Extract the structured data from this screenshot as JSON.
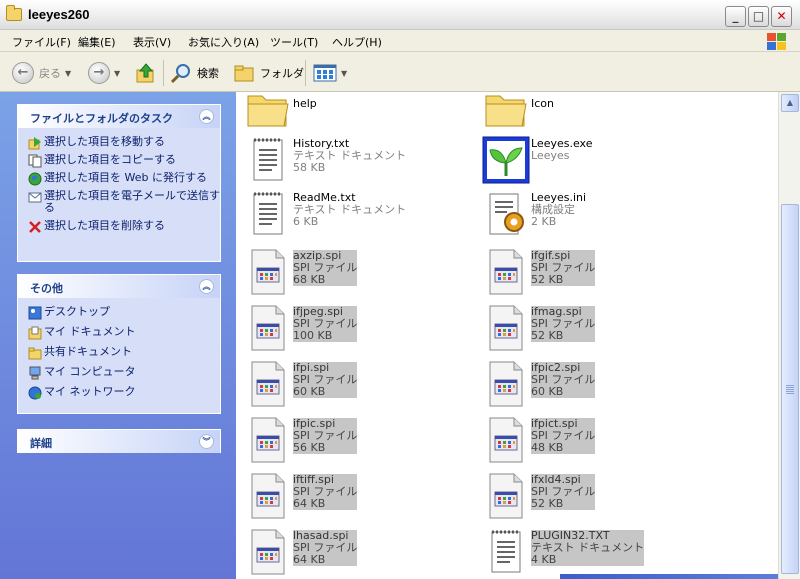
{
  "window": {
    "title": "leeyes260"
  },
  "menu": [
    "ファイル(F)",
    "編集(E)",
    "表示(V)",
    "お気に入り(A)",
    "ツール(T)",
    "ヘルプ(H)"
  ],
  "toolbar": {
    "back": "戻る",
    "forward": "",
    "search": "検索",
    "folders": "フォルダ"
  },
  "tasks": {
    "file_tasks": {
      "title": "ファイルとフォルダのタスク",
      "items": [
        "選択した項目を移動する",
        "選択した項目をコピーする",
        "選択した項目を Web に発行する",
        "選択した項目を電子メールで送信する",
        "選択した項目を削除する"
      ]
    },
    "other": {
      "title": "その他",
      "items": [
        "デスクトップ",
        "マイ ドキュメント",
        "共有ドキュメント",
        "マイ コンピュータ",
        "マイ ネットワーク"
      ]
    },
    "details": {
      "title": "詳細"
    }
  },
  "files": [
    {
      "name": "help",
      "type": "",
      "size": "",
      "icon": "folder-icon",
      "selected": false
    },
    {
      "name": "Icon",
      "type": "",
      "size": "",
      "icon": "folder-icon",
      "selected": false
    },
    {
      "name": "History.txt",
      "type": "テキスト ドキュメント",
      "size": "58 KB",
      "icon": "text-document-icon",
      "selected": false
    },
    {
      "name": "Leeyes.exe",
      "type": "Leeyes",
      "size": "",
      "icon": "leeyes-app-icon",
      "selected": false
    },
    {
      "name": "ReadMe.txt",
      "type": "テキスト ドキュメント",
      "size": "6 KB",
      "icon": "text-document-icon",
      "selected": false
    },
    {
      "name": "Leeyes.ini",
      "type": "構成設定",
      "size": "2 KB",
      "icon": "config-settings-icon",
      "selected": false
    },
    {
      "name": "axzip.spi",
      "type": "SPI ファイル",
      "size": "68 KB",
      "icon": "spi-file-icon",
      "selected": true
    },
    {
      "name": "ifgif.spi",
      "type": "SPI ファイル",
      "size": "52 KB",
      "icon": "spi-file-icon",
      "selected": true
    },
    {
      "name": "ifjpeg.spi",
      "type": "SPI ファイル",
      "size": "100 KB",
      "icon": "spi-file-icon",
      "selected": true
    },
    {
      "name": "ifmag.spi",
      "type": "SPI ファイル",
      "size": "52 KB",
      "icon": "spi-file-icon",
      "selected": true
    },
    {
      "name": "ifpi.spi",
      "type": "SPI ファイル",
      "size": "60 KB",
      "icon": "spi-file-icon",
      "selected": true
    },
    {
      "name": "ifpic2.spi",
      "type": "SPI ファイル",
      "size": "60 KB",
      "icon": "spi-file-icon",
      "selected": true
    },
    {
      "name": "ifpic.spi",
      "type": "SPI ファイル",
      "size": "56 KB",
      "icon": "spi-file-icon",
      "selected": true
    },
    {
      "name": "ifpict.spi",
      "type": "SPI ファイル",
      "size": "48 KB",
      "icon": "spi-file-icon",
      "selected": true
    },
    {
      "name": "iftiff.spi",
      "type": "SPI ファイル",
      "size": "64 KB",
      "icon": "spi-file-icon",
      "selected": true
    },
    {
      "name": "ifxld4.spi",
      "type": "SPI ファイル",
      "size": "52 KB",
      "icon": "spi-file-icon",
      "selected": true
    },
    {
      "name": "lhasad.spi",
      "type": "SPI ファイル",
      "size": "64 KB",
      "icon": "spi-file-icon",
      "selected": true
    },
    {
      "name": "PLUGIN32.TXT",
      "type": "テキスト ドキュメント",
      "size": "4 KB",
      "icon": "text-document-icon",
      "selected": true
    }
  ]
}
